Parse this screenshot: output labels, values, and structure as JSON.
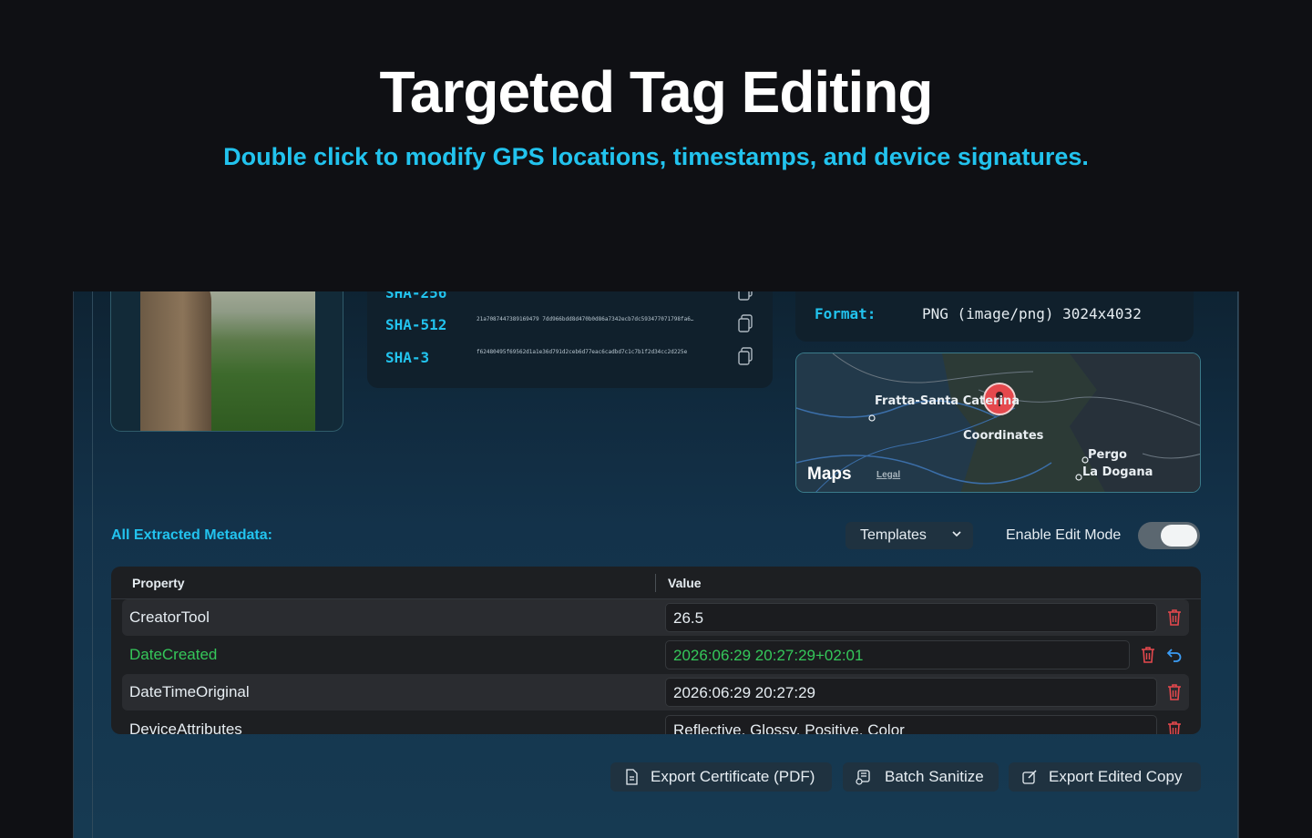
{
  "hero": {
    "title": "Targeted Tag Editing",
    "subtitle": "Double click to modify GPS locations, timestamps, and device signatures."
  },
  "hashes": [
    {
      "label": "SHA-256",
      "value": ""
    },
    {
      "label": "SHA-512",
      "value": "21a7087447389169479 7dd966bdd8d470b0d86a7342ecb7dc593477071798fa6…"
    },
    {
      "label": "SHA-3",
      "value": "f62480495f69562d1a1e36d791d2ceb6d77eac6cadbd7c1c7b1f2d34cc2d225e"
    }
  ],
  "file_info": {
    "format_label": "Format:",
    "format_value": "PNG (image/png) 3024x4032"
  },
  "map": {
    "places": [
      "Fratta-Santa Caterina",
      "Coordinates",
      "Pergo",
      "La Dogana"
    ],
    "brand": "Maps",
    "legal": "Legal"
  },
  "metadata": {
    "section_title": "All Extracted Metadata:",
    "templates_label": "Templates",
    "edit_mode_label": "Enable Edit Mode",
    "edit_mode_on": true,
    "columns": [
      "Property",
      "Value"
    ],
    "rows": [
      {
        "property": "CreatorTool",
        "value": "26.5",
        "modified": false
      },
      {
        "property": "DateCreated",
        "value": "2026:06:29 20:27:29+02:01",
        "modified": true
      },
      {
        "property": "DateTimeOriginal",
        "value": "2026:06:29 20:27:29",
        "modified": false
      },
      {
        "property": "DeviceAttributes",
        "value": "Reflective, Glossy, Positive, Color",
        "modified": false
      }
    ]
  },
  "actions": {
    "export_certificate": "Export Certificate (PDF)",
    "batch_sanitize": "Batch Sanitize",
    "export_copy": "Export Edited Copy"
  },
  "icons": [
    "copy-icon",
    "chevron-down-icon",
    "trash-icon",
    "revert-icon",
    "document-icon",
    "batch-icon",
    "edit-icon",
    "map-pin-icon",
    "apple-icon"
  ],
  "colors": {
    "accent": "#22c3ee",
    "modified": "#35c75a",
    "danger": "#e5484d",
    "revert": "#3b9cf5"
  }
}
